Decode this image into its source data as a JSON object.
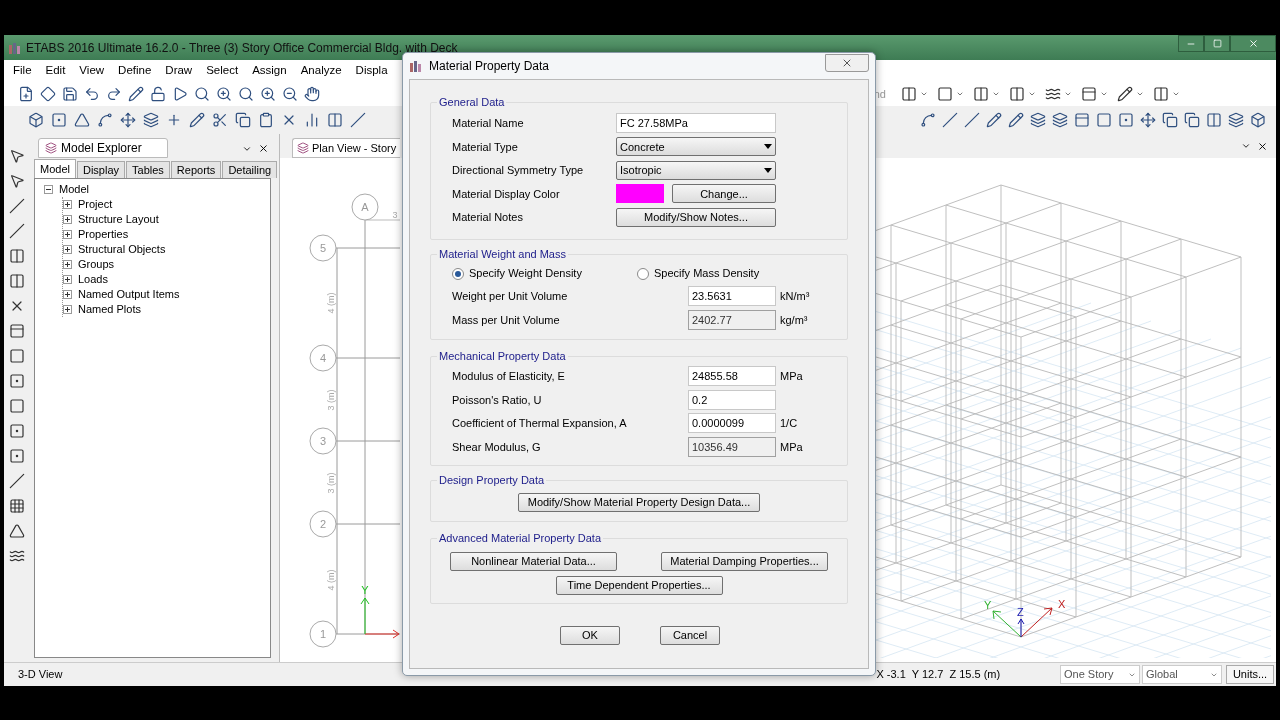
{
  "window": {
    "title": "ETABS 2016 Ultimate 16.2.0 - Three (3) Story Office Commercial Bldg. with Deck"
  },
  "menu": [
    "File",
    "Edit",
    "View",
    "Define",
    "Draw",
    "Select",
    "Assign",
    "Analyze",
    "Displa"
  ],
  "toolbar_fragment": "nd",
  "explorer": {
    "title": "Model Explorer",
    "tabs": [
      {
        "label": "Model",
        "selected": true
      },
      {
        "label": "Display",
        "selected": false
      },
      {
        "label": "Tables",
        "selected": false
      },
      {
        "label": "Reports",
        "selected": false
      },
      {
        "label": "Detailing",
        "selected": false
      }
    ],
    "tree": {
      "label": "Model",
      "expanded": true,
      "children": [
        {
          "label": "Project",
          "expanded": false
        },
        {
          "label": "Structure Layout",
          "expanded": false
        },
        {
          "label": "Properties",
          "expanded": false
        },
        {
          "label": "Structural Objects",
          "expanded": false
        },
        {
          "label": "Groups",
          "expanded": false
        },
        {
          "label": "Loads",
          "expanded": false
        },
        {
          "label": "Named Output Items",
          "expanded": false
        },
        {
          "label": "Named Plots",
          "expanded": false
        }
      ]
    }
  },
  "plan_view": {
    "tab": "Plan View - Story",
    "column_grid": "A",
    "top_dimension": "3",
    "row_grids": [
      "5",
      "4",
      "3",
      "2",
      "1"
    ],
    "spacings": [
      "4 (m)",
      "3 (m)",
      "3 (m)",
      "4 (m)"
    ],
    "axis_label": "Y"
  },
  "view_3d": {
    "axis_labels": [
      "X",
      "Y",
      "Z"
    ]
  },
  "dialog": {
    "title": "Material Property Data",
    "general": {
      "heading": "General Data",
      "name_label": "Material Name",
      "name": "FC 27.58MPa",
      "type_label": "Material Type",
      "type": "Concrete",
      "symmetry_label": "Directional Symmetry Type",
      "symmetry": "Isotropic",
      "color_label": "Material Display Color",
      "color": "#ff00ff",
      "change_button": "Change...",
      "notes_label": "Material Notes",
      "notes_button": "Modify/Show Notes..."
    },
    "weight": {
      "heading": "Material Weight and Mass",
      "options": [
        {
          "label": "Specify Weight Density",
          "selected": true
        },
        {
          "label": "Specify Mass Density",
          "selected": false
        }
      ],
      "rows": [
        {
          "label": "Weight per Unit Volume",
          "value": "23.5631",
          "unit": "kN/m³",
          "disabled": false
        },
        {
          "label": "Mass per Unit Volume",
          "value": "2402.77",
          "unit": "kg/m³",
          "disabled": true
        }
      ]
    },
    "mechanical": {
      "heading": "Mechanical Property Data",
      "rows": [
        {
          "label": "Modulus of Elasticity,  E",
          "value": "24855.58",
          "unit": "MPa",
          "disabled": false
        },
        {
          "label": "Poisson's Ratio,  U",
          "value": "0.2",
          "disabled": false
        },
        {
          "label": "Coefficient of Thermal Expansion,  A",
          "value": "0.0000099",
          "unit": "1/C",
          "disabled": false
        },
        {
          "label": "Shear Modulus,  G",
          "value": "10356.49",
          "unit": "MPa",
          "disabled": true
        }
      ]
    },
    "design": {
      "heading": "Design Property Data",
      "button": "Modify/Show Material Property Design Data..."
    },
    "advanced": {
      "heading": "Advanced Material Property Data",
      "buttons": [
        "Nonlinear Material Data...",
        "Material Damping Properties...",
        "Time Dependent Properties..."
      ]
    },
    "ok": "OK",
    "cancel": "Cancel"
  },
  "status_bar": {
    "view": "3-D View",
    "coordinates": "X -3.1  Y 12.7  Z 15.5 (m)",
    "story": "One Story",
    "system": "Global",
    "units": "Units..."
  }
}
